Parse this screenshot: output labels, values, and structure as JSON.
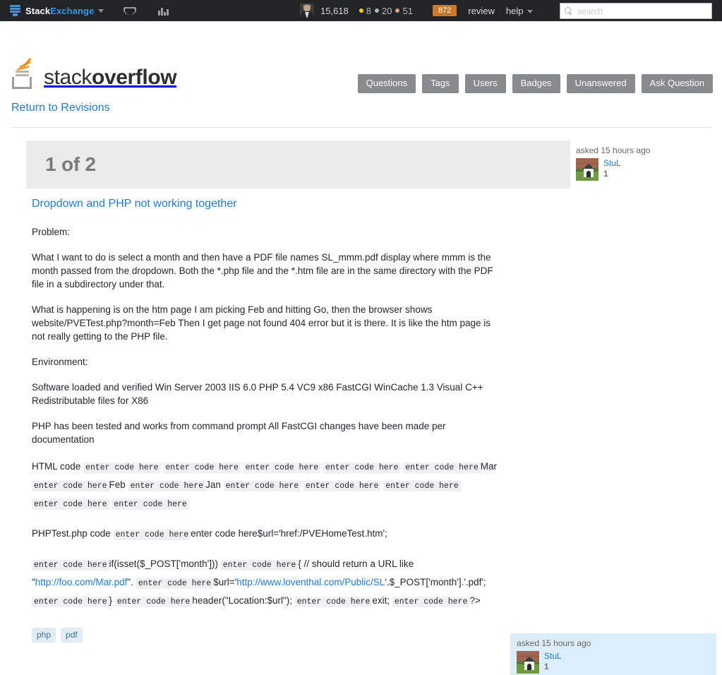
{
  "topbar": {
    "network_name_prefix": "Stack",
    "network_name_suffix": "Exchange",
    "inbox_icon": "inbox-icon",
    "achievements_icon": "achievements-icon",
    "reputation": "15,618",
    "gold_badges": "8",
    "silver_badges": "20",
    "bronze_badges": "51",
    "review_count": "872",
    "review_label": "review",
    "help_label": "help",
    "search_placeholder": "search",
    "search_value": "",
    "colors": {
      "bar_background": "#222426",
      "accent_blue": "#2d9ae8",
      "review_orange": "#cc7a27",
      "gold": "#ffcc01",
      "silver": "#b4b8bc",
      "bronze": "#d1a684"
    }
  },
  "site_header": {
    "logo_text_light": "stack",
    "logo_text_bold": "overflow",
    "nav": [
      {
        "label": "Questions",
        "name": "nav-questions"
      },
      {
        "label": "Tags",
        "name": "nav-tags"
      },
      {
        "label": "Users",
        "name": "nav-users"
      },
      {
        "label": "Badges",
        "name": "nav-badges"
      },
      {
        "label": "Unanswered",
        "name": "nav-unanswered"
      },
      {
        "label": "Ask Question",
        "name": "nav-ask-question"
      }
    ],
    "nav_button_color": "#888b8d"
  },
  "breadcrumb": {
    "return_link": "Return to Revisions"
  },
  "revision": {
    "header_title": "1 of 2",
    "header_background": "#ebebeb"
  },
  "user_card_top": {
    "asked": "asked 15 hours ago",
    "user_name": "StuL",
    "reputation": "1",
    "avatar_icon": "doghouse-avatar"
  },
  "user_card_bottom": {
    "asked": "asked 15 hours ago",
    "user_name": "StuL",
    "reputation": "1",
    "avatar_icon": "doghouse-avatar",
    "background": "#dceefb"
  },
  "post": {
    "title": "Dropdown and PHP not working together",
    "paragraphs": {
      "p1": "Problem:",
      "p2": "What I want to do is select a month and then have a PDF file names SL_mmm.pdf display where mmm is the month passed from the dropdown. Both the *.php file and the *.htm file are in the same directory with the PDF file in a subdirectory under that.",
      "p3": "What is happening is on the htm page I am picking Feb and hitting Go, then the browser shows website/PVETest.php?month=Feb Then I get page not found 404 error but it is there. It is like the htm page is not really getting to the PHP file.",
      "p4": "Environment:",
      "p5": "Software loaded and verified Win Server 2003 IIS 6.0 PHP 5.4 VC9 x86 FastCGI WinCache 1.3 Visual C++ Redistributable files for X86",
      "p6": "PHP has been tested and works from command prompt All FastCGI changes have been made per documentation"
    },
    "code_placeholder": "enter code here",
    "html_code": {
      "label": "HTML code",
      "month_mar": "Mar",
      "month_feb": "Feb",
      "month_jan": "Jan"
    },
    "php_code": {
      "label": "PHPTest.php code",
      "seg1": "enter code here$url='href:/PVEHomeTest.htm';",
      "seg2": "if(isset($_POST['month']))",
      "seg3": "{ // should return a URL like",
      "quote_open": "\"",
      "link1_text": "http://foo.com/Mar.pdf",
      "after_link1": "\".",
      "assign": "$url='",
      "link2_text": "http://www.loventhal.com/Public/SL",
      "after_link2": "'.$_POST['month'].'.pdf';",
      "brace_close": "}",
      "header_call": "header(\"Location:$url\");",
      "exit_stmt": "exit;",
      "php_close": "?>"
    },
    "tags": [
      {
        "label": "php",
        "name": "tag-php"
      },
      {
        "label": "pdf",
        "name": "tag-pdf"
      }
    ]
  }
}
